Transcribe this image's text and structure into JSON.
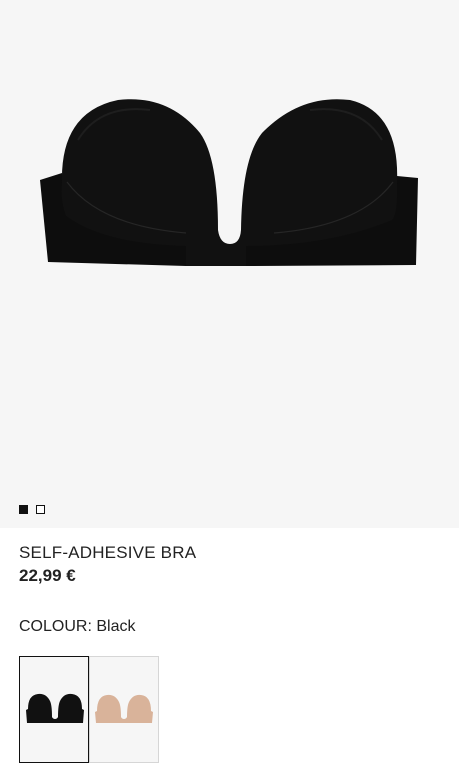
{
  "product": {
    "name": "SELF-ADHESIVE BRA",
    "price": "22,99 €",
    "image_alt": "SELF-ADHESIVE BRA"
  },
  "gallery": {
    "pages": 2,
    "active_index": 0
  },
  "colour": {
    "label": "COLOUR:",
    "selected": "Black",
    "options": [
      {
        "name": "Black",
        "color": "#111111",
        "selected": true
      },
      {
        "name": "Nude",
        "color": "#d9b39a",
        "selected": false
      }
    ]
  },
  "theme": {
    "background": "#f6f6f6",
    "text": "#222222"
  }
}
